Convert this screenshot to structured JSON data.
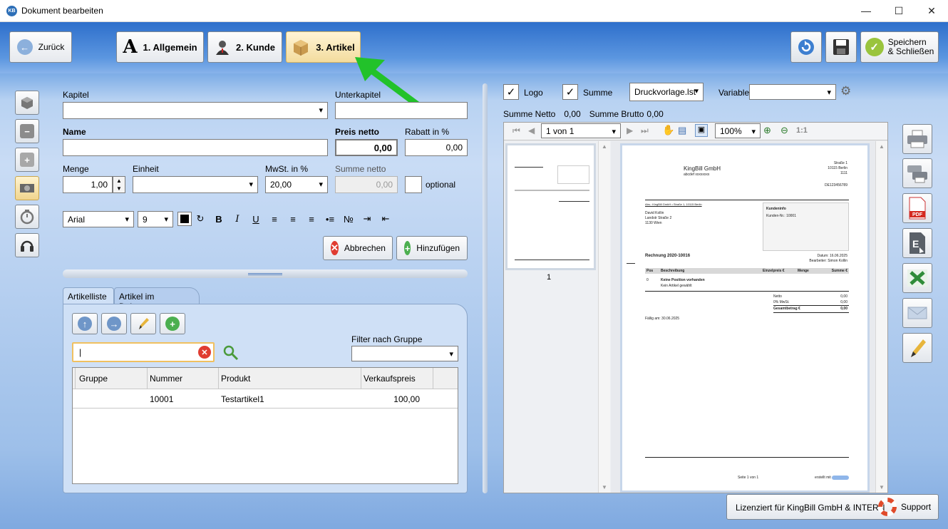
{
  "window": {
    "title": "Dokument bearbeiten",
    "logo_text": "KB"
  },
  "toolbar": {
    "back_label": "Zurück",
    "tabs": [
      {
        "label": "1. Allgemein",
        "icon": "letter-a-icon"
      },
      {
        "label": "2. Kunde",
        "icon": "person-icon"
      },
      {
        "label": "3. Artikel",
        "icon": "box-icon",
        "active": true
      }
    ],
    "save_close_line1": "Speichern",
    "save_close_line2": "& Schließen"
  },
  "form": {
    "kapitel_label": "Kapitel",
    "unterkapitel_label": "Unterkapitel",
    "name_label": "Name",
    "preis_netto_label": "Preis netto",
    "preis_netto_value": "0,00",
    "rabatt_label": "Rabatt in %",
    "rabatt_value": "0,00",
    "menge_label": "Menge",
    "menge_value": "1,00",
    "einheit_label": "Einheit",
    "mwst_label": "MwSt. in %",
    "mwst_value": "20,00",
    "summe_netto_label": "Summe netto",
    "summe_netto_value": "0,00",
    "optional_label": "optional",
    "font_name": "Arial",
    "font_size": "9",
    "cancel_label": "Abbrechen",
    "add_label": "Hinzufügen"
  },
  "tabs": [
    {
      "label": "Artikelliste",
      "active": true
    },
    {
      "label": "Artikel im Dokument",
      "active": false
    }
  ],
  "articles": {
    "search_value": "|",
    "filter_label": "Filter nach Gruppe",
    "columns": [
      "Gruppe",
      "Nummer",
      "Produkt",
      "Verkaufspreis"
    ],
    "rows": [
      {
        "gruppe": "",
        "nummer": "10001",
        "produkt": "Testartikel1",
        "preis": "100,00"
      }
    ]
  },
  "preview": {
    "logo_label": "Logo",
    "summe_label": "Summe",
    "template": "Druckvorlage.lst",
    "variable_label": "Variable",
    "summe_netto_label": "Summe Netto",
    "summe_netto_value": "0,00",
    "summe_brutto_label": "Summe Brutto",
    "summe_brutto_value": "0,00",
    "page_indicator": "1 von 1",
    "zoom": "100%",
    "zoom_11": "1:1",
    "thumb_page_number": "1"
  },
  "document": {
    "company": "KingBill GmbH",
    "company_sub": "abcdef xxxxxxxx",
    "addr_r1": "Straße 1",
    "addr_r2": "10115 Berlin",
    "addr_r3": "1111",
    "vat": "DE123456789",
    "sender_line": "Abs.: KingBill GmbH • Straße 1, 10115 Berlin",
    "recipient_1": "David Kollin",
    "recipient_2": "Landstr Straße 2",
    "recipient_3": "1130 Wien",
    "info_title": "Kundeninfo",
    "info_line": "Kunden-Nr.:   10001",
    "invoice_title": "Rechnung 2020-10016",
    "date_line": "Datum: 16.06.2025",
    "editor_line": "Bearbeiter:  Simon Kollin",
    "col_pos": "Pos",
    "col_desc": "Beschreibung",
    "col_unit_price": "Einzelpreis €",
    "col_qty": "Menge",
    "col_total": "Summe €",
    "row_pos": "0",
    "row_desc": "Keine Position vorhanden",
    "row_desc2": "Kein Artikel gewählt",
    "netto_label": "Netto",
    "netto_value": "0,00",
    "mwst_label": "0% MwSt.",
    "mwst_value": "0,00",
    "gesamt_label": "Gesamtbetrag €",
    "gesamt_value": "0,00",
    "due_line": "Fällig am: 30.06.2025",
    "page_footer": "Seite 1 von 1",
    "created_with": "erstellt mit"
  },
  "status": {
    "license_text": "Lizenziert für KingBill GmbH & INTERN",
    "support_label": "Support"
  },
  "colors": {
    "accent": "#2e6fcb",
    "arrow": "#22c22a",
    "active_tab": "#f3dc9e"
  }
}
